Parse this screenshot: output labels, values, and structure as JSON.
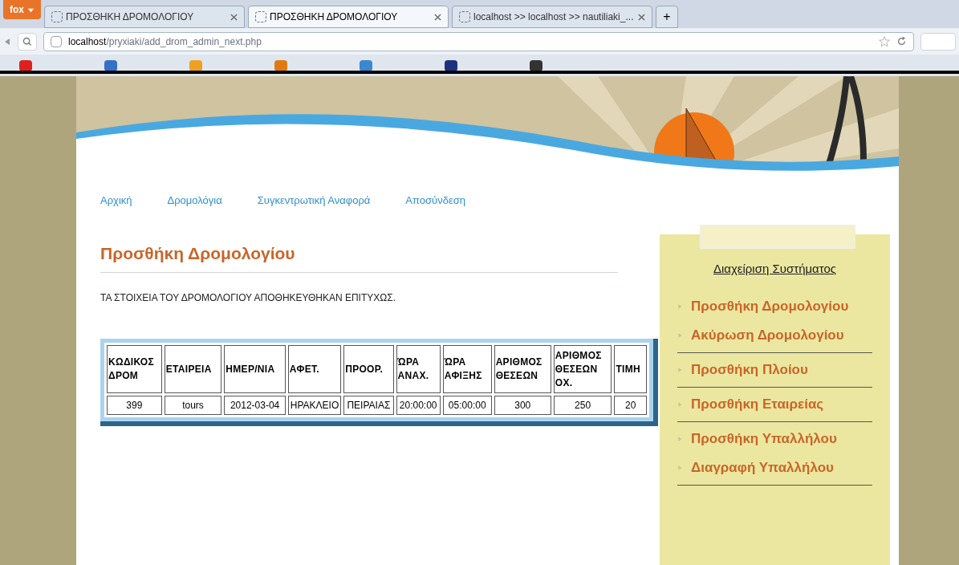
{
  "browser": {
    "menu_button": "fox",
    "tabs": [
      {
        "title": "ΠΡΟΣΘΗΚΗ ΔΡΟΜΟΛΟΓΙΟΥ",
        "selected": false
      },
      {
        "title": "ΠΡΟΣΘΗΚΗ ΔΡΟΜΟΛΟΓΙΟΥ",
        "selected": true
      },
      {
        "title": "localhost >> localhost >> nautiliaki_...",
        "selected": false
      }
    ],
    "new_tab": "+",
    "url_host": "localhost",
    "url_path": "/pryxiaki/add_drom_admin_next.php"
  },
  "nav": [
    "Αρχική",
    "Δρομολόγια",
    "Συγκεντρωτική Αναφορά",
    "Αποσύνδεση"
  ],
  "page_title": "Προσθήκη Δρομολογίου",
  "message": "ΤΑ ΣΤΟΙΧΕΙΑ ΤΟΥ ΔΡΟΜΟΛΟΓΙΟΥ ΑΠΟΘΗΚΕΥΘΗΚΑΝ ΕΠΙΤΥΧΩΣ.",
  "table": {
    "columns": [
      "ΚΩΔΙΚΟΣ ΔΡΟΜ",
      "ΕΤΑΙΡΕΙΑ",
      "ΗΜΕΡ/ΝΙΑ",
      "ΑΦΕΤ.",
      "ΠΡΟΟΡ.",
      "ΏΡΑ ΑΝΑΧ.",
      "ΏΡΑ ΑΦΙΞΗΣ",
      "ΑΡΙΘΜΟΣ ΘΕΣΕΩΝ",
      "ΑΡΙΘΜΟΣ ΘΕΣΕΩΝ ΟΧ.",
      "ΤΙΜΗ"
    ],
    "rows": [
      [
        "399",
        "tours",
        "2012-03-04",
        "ΗΡΑΚΛΕΙΟ",
        "ΠΕΙΡΑΙΑΣ",
        "20:00:00",
        "05:00:00",
        "300",
        "250",
        "20"
      ]
    ]
  },
  "sidebar": {
    "title": "Διαχείριση Συστήματος",
    "groups": [
      [
        "Προσθήκη Δρομολογίου",
        "Ακύρωση Δρομολογίου"
      ],
      [
        "Προσθήκη Πλοίου"
      ],
      [
        "Προσθήκη Εταιρείας"
      ],
      [
        "Προσθήκη Υπαλλήλου",
        "Διαγραφή Υπαλλήλου"
      ]
    ]
  }
}
